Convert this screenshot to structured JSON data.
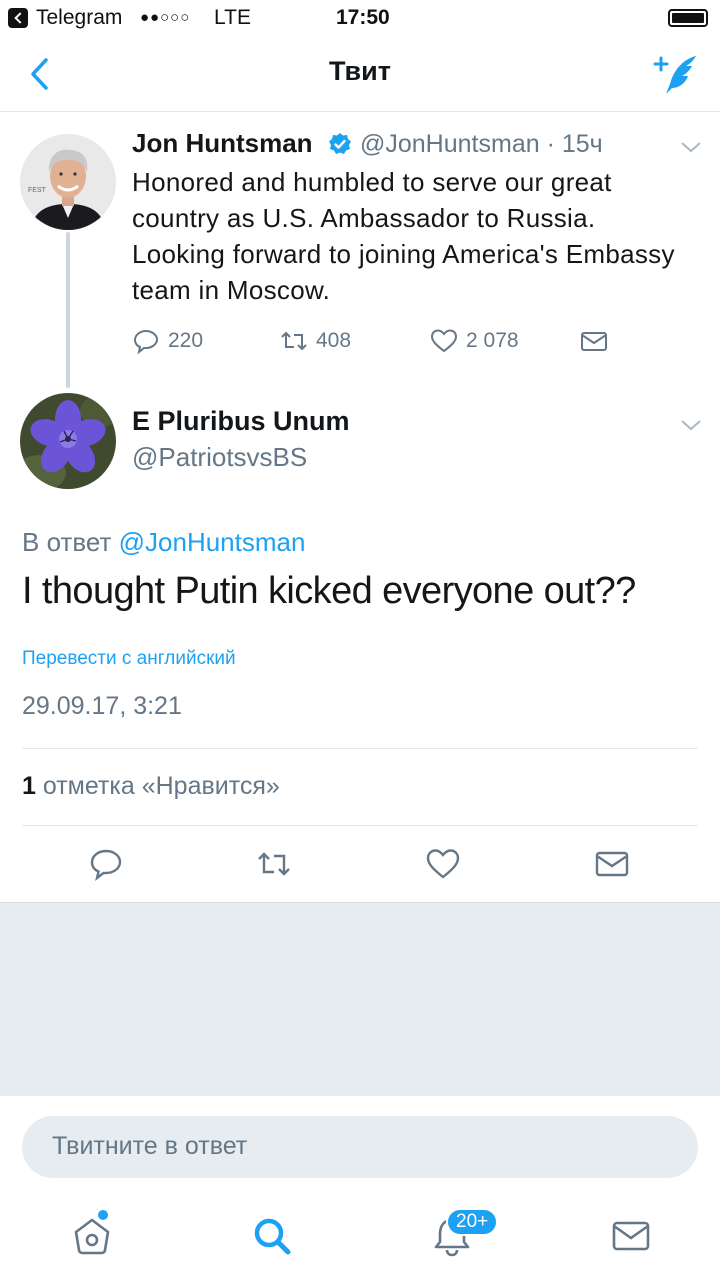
{
  "status_bar": {
    "app": "Telegram",
    "signal": "●●○○○",
    "network": "LTE",
    "time": "17:50"
  },
  "nav": {
    "title": "Твит",
    "back_icon": "chevron-left-icon",
    "compose_icon": "compose-tweet-icon"
  },
  "original_tweet": {
    "name": "Jon Huntsman",
    "verified": true,
    "handle": "@JonHuntsman",
    "time": "· 15ч",
    "text": "Honored and humbled to serve our great country as U.S. Ambassador to Russia. Looking forward to joining America's Embassy team in Moscow.",
    "replies": "220",
    "retweets": "408",
    "likes": "2 078"
  },
  "reply_tweet": {
    "name": "E Pluribus Unum",
    "handle": "@PatriotsvsBS",
    "reply_prefix": "В ответ",
    "reply_to": "@JonHuntsman",
    "text": "I thought Putin kicked everyone out??",
    "translate": "Перевести с английский",
    "timestamp": "29.09.17, 3:21",
    "like_count": "1",
    "like_label": "отметка «Нравится»"
  },
  "reply_input": {
    "placeholder": "Твитните в ответ"
  },
  "tabbar": {
    "items": [
      "home-icon",
      "search-icon",
      "notifications-icon",
      "messages-icon"
    ],
    "notifications_badge": "20+"
  },
  "colors": {
    "accent": "#1da1f2",
    "secondary_text": "#657786",
    "divider": "#e1e8ed",
    "background_gray": "#e6ecf0"
  }
}
